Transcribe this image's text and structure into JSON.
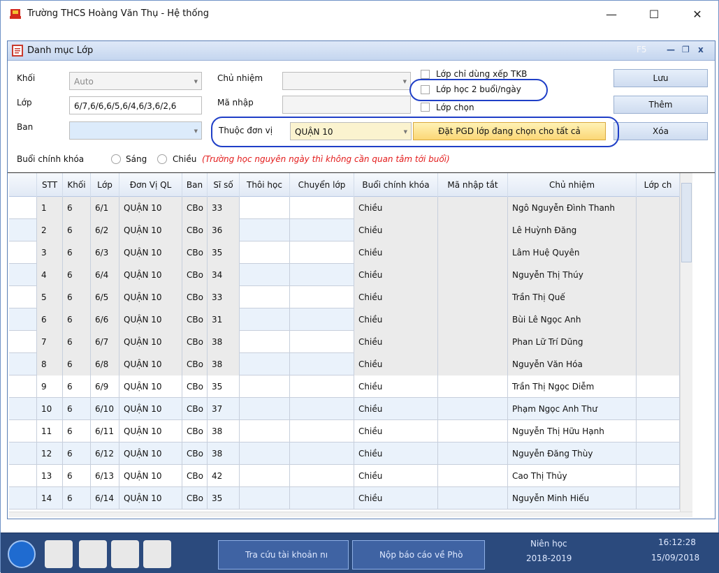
{
  "window": {
    "title": "Trường THCS  Hoàng Văn Thụ - Hệ thống",
    "minimize": "—",
    "maximize": "☐",
    "close": "✕"
  },
  "form_window": {
    "title": "Danh mục Lớp",
    "f5": "F5",
    "min": "—",
    "restore": "❐",
    "close": "x"
  },
  "form": {
    "khoi_label": "Khối",
    "khoi_value": "Auto",
    "lop_label": "Lớp",
    "lop_value": "6/7,6/6,6/5,6/4,6/3,6/2,6",
    "ban_label": "Ban",
    "chu_nhiem_label": "Chủ nhiệm",
    "ma_nhap_label": "Mã nhập",
    "thuoc_don_vi_label": "Thuộc đơn vị",
    "thuoc_don_vi_value": "QUẬN 10",
    "checkboxes": [
      "Lớp chỉ dùng xếp TKB",
      "Lớp học 2 buổi/ngày",
      "Lớp chọn"
    ],
    "pgd_button": "Đặt PGD lớp đang chọn cho tất cả",
    "buttons": {
      "save": "Lưu",
      "add": "Thêm",
      "delete": "Xóa"
    },
    "buoi_label": "Buổi chính khóa",
    "sang": "Sáng",
    "chieu": "Chiều",
    "note": "(Trường học nguyên ngày thì không cần quan tâm tới buổi)"
  },
  "grid": {
    "columns": [
      "STT",
      "Khối",
      "Lớp",
      "Đơn Vị QL",
      "Ban",
      "Sĩ số",
      "Thôi học",
      "Chuyển lớp",
      "Buổi chính khóa",
      "Mã nhập tắt",
      "Chủ nhiệm",
      "Lớp ch"
    ],
    "rows": [
      [
        "1",
        "6",
        "6/1",
        "QUẬN 10",
        "CBo",
        "33",
        "",
        "",
        "Chiều",
        "",
        "Ngô Nguyễn Đình Thanh",
        ""
      ],
      [
        "2",
        "6",
        "6/2",
        "QUẬN 10",
        "CBo",
        "36",
        "",
        "",
        "Chiều",
        "",
        "Lê Huỳnh Đăng",
        ""
      ],
      [
        "3",
        "6",
        "6/3",
        "QUẬN 10",
        "CBo",
        "35",
        "",
        "",
        "Chiều",
        "",
        "Lâm Huệ Quyên",
        ""
      ],
      [
        "4",
        "6",
        "6/4",
        "QUẬN 10",
        "CBo",
        "34",
        "",
        "",
        "Chiều",
        "",
        "Nguyễn Thị Thúy",
        ""
      ],
      [
        "5",
        "6",
        "6/5",
        "QUẬN 10",
        "CBo",
        "33",
        "",
        "",
        "Chiều",
        "",
        "Trần Thị Quế",
        ""
      ],
      [
        "6",
        "6",
        "6/6",
        "QUẬN 10",
        "CBo",
        "31",
        "",
        "",
        "Chiều",
        "",
        "Bùi Lê Ngọc Anh",
        ""
      ],
      [
        "7",
        "6",
        "6/7",
        "QUẬN 10",
        "CBo",
        "38",
        "",
        "",
        "Chiều",
        "",
        "Phan Lữ Trí Dũng",
        ""
      ],
      [
        "8",
        "6",
        "6/8",
        "QUẬN 10",
        "CBo",
        "38",
        "",
        "",
        "Chiều",
        "",
        "Nguyễn Văn Hóa",
        ""
      ],
      [
        "9",
        "6",
        "6/9",
        "QUẬN 10",
        "CBo",
        "35",
        "",
        "",
        "Chiều",
        "",
        "Trần Thị Ngọc Diễm",
        ""
      ],
      [
        "10",
        "6",
        "6/10",
        "QUẬN 10",
        "CBo",
        "37",
        "",
        "",
        "Chiều",
        "",
        "Phạm Ngọc Anh Thư",
        ""
      ],
      [
        "11",
        "6",
        "6/11",
        "QUẬN 10",
        "CBo",
        "38",
        "",
        "",
        "Chiều",
        "",
        "Nguyễn Thị Hữu Hạnh",
        ""
      ],
      [
        "12",
        "6",
        "6/12",
        "QUẬN 10",
        "CBo",
        "38",
        "",
        "",
        "Chiều",
        "",
        "Nguyễn Đăng Thùy",
        ""
      ],
      [
        "13",
        "6",
        "6/13",
        "QUẬN 10",
        "CBo",
        "42",
        "",
        "",
        "Chiều",
        "",
        "Cao Thị Thủy",
        ""
      ],
      [
        "14",
        "6",
        "6/14",
        "QUẬN 10",
        "CBo",
        "35",
        "",
        "",
        "Chiều",
        "",
        "Nguyễn Minh Hiếu",
        ""
      ]
    ]
  },
  "taskbar": {
    "task1": "Tra cứu tài khoản nı",
    "task2": "Nộp báo cáo về Phò",
    "nien_hoc_label": "Niên học",
    "nien_hoc_value": "2018-2019",
    "time": "16:12:28",
    "date": "15/09/2018"
  },
  "colors": {
    "accent_ring": "#1f3fc7",
    "note_red": "#e31b1b",
    "row_alt": "#eaf2fb",
    "taskbar": "#2b4a7d"
  }
}
